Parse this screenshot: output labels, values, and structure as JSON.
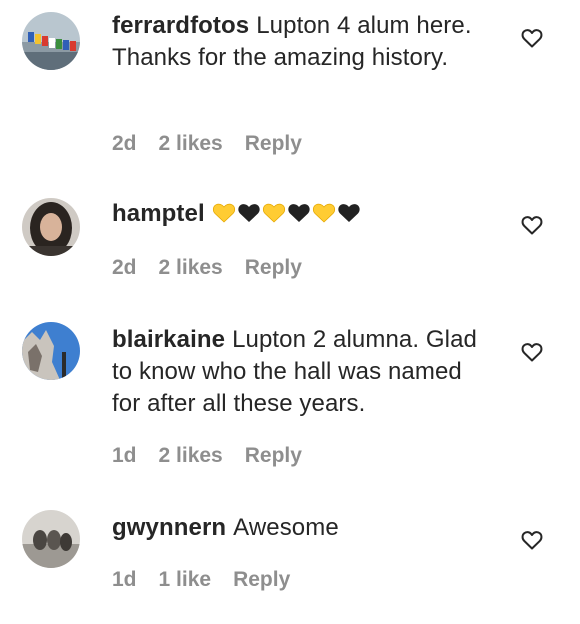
{
  "comments": [
    {
      "username": "ferrardfotos",
      "text": "Lupton 4 alum here. Thanks for the amazing history.",
      "time": "2d",
      "likes": "2 likes",
      "reply": "Reply"
    },
    {
      "username": "hamptel",
      "text": "",
      "emoji": [
        "yellow-heart",
        "black-heart",
        "yellow-heart",
        "black-heart",
        "yellow-heart",
        "black-heart"
      ],
      "time": "2d",
      "likes": "2 likes",
      "reply": "Reply"
    },
    {
      "username": "blairkaine",
      "text": "Lupton 2 alumna. Glad to know who the hall was named for after all these years.",
      "time": "1d",
      "likes": "2 likes",
      "reply": "Reply"
    },
    {
      "username": "gwynnern",
      "text": "Awesome",
      "time": "1d",
      "likes": "1 like",
      "reply": "Reply"
    }
  ],
  "colors": {
    "text": "#262626",
    "meta": "#8e8e8e",
    "yellow_heart": "#FFCC33",
    "black_heart": "#222222"
  },
  "icons": {
    "like": "heart-outline-icon"
  }
}
